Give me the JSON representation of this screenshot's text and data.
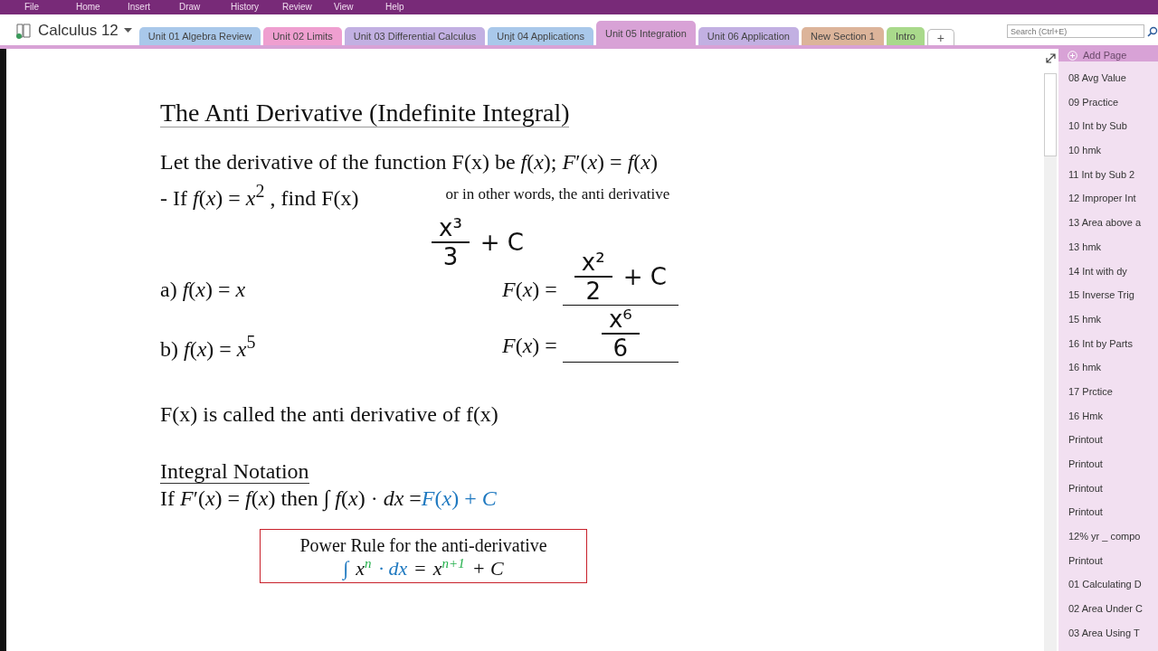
{
  "menu": [
    "File",
    "Home",
    "Insert",
    "Draw",
    "History",
    "Review",
    "View",
    "Help"
  ],
  "notebook": {
    "name": "Calculus 12"
  },
  "tabs": [
    {
      "label": "Unit 01 Algebra Review",
      "color": "#a9c8ea",
      "selected": false
    },
    {
      "label": "Unit 02 Limits",
      "color": "#ef9fd0",
      "selected": false
    },
    {
      "label": "Unit 03 Differential Calculus",
      "color": "#c2b0e2",
      "selected": false
    },
    {
      "label": "Unjt 04 Applications",
      "color": "#a9c8ea",
      "selected": false
    },
    {
      "label": "Unit 05 Integration",
      "color": "#d8a2d6",
      "selected": true
    },
    {
      "label": "Unit 06 Application",
      "color": "#c2b0e2",
      "selected": false
    },
    {
      "label": "New Section 1",
      "color": "#dcb49a",
      "selected": false
    },
    {
      "label": "Intro",
      "color": "#a9d98b",
      "selected": false
    }
  ],
  "add_tab": "+",
  "search": {
    "placeholder": "Search (Ctrl+E)"
  },
  "pages_panel": {
    "add_page": "Add Page",
    "pages": [
      "08 Avg Value",
      "09 Practice",
      "10 Int by Sub",
      "10 hmk",
      "11 Int by Sub 2",
      "12 Improper Int",
      "13 Area above a",
      "13 hmk",
      "14 Int with dy",
      "15 Inverse Trig",
      "15 hmk",
      "16 Int by Parts",
      "16 hmk",
      "17 Prctice",
      "16 Hmk",
      "Printout",
      "Printout",
      "Printout",
      "Printout",
      "12% yr _ compo",
      "Printout",
      "01 Calculating D",
      "02 Area Under C",
      "03 Area Using T"
    ]
  },
  "page": {
    "title": "The Anti Derivative (Indefinite Integral)",
    "definition": "Let the derivative of the function F(x)  be *f*(*x*); *F*′(*x*) = *f*(*x*)",
    "question": "-  If *f*(*x*)  =  *x*$^{2}$ , find F(x)",
    "question_note": "or in other words, the anti derivative",
    "question_ink": {
      "numerator": "x³",
      "denominator": "3",
      "suffix": "+ C"
    },
    "problems": [
      {
        "prompt": "a) *f*(*x*)  =  *x*",
        "answer_label": "*F*(*x*) =",
        "ink": {
          "numerator": "x²",
          "denominator": "2",
          "suffix": "+ C"
        }
      },
      {
        "prompt": "b) *f*(*x*)  =  *x*$^{5}$",
        "answer_label": "*F*(*x*)  =",
        "ink": {
          "numerator": "x⁶",
          "denominator": "6"
        }
      }
    ],
    "statement": "F(x) is called the anti derivative of f(x)",
    "notation_heading": "Integral Notation",
    "notation": "If *F*′(*x*)  =  *f*(*x*) then ∫ *f*(*x*)  · *dx* = ",
    "notation_result": "*F*(*x*) + *C*",
    "rule_box": {
      "title": "Power Rule for the anti-derivative",
      "integral": "∫",
      "base": "x",
      "exponent": "n",
      "differential": "· dx",
      "equals": "=",
      "numerator_base": "x",
      "numerator_exponent": "n+1",
      "constant": "+ C"
    }
  }
}
